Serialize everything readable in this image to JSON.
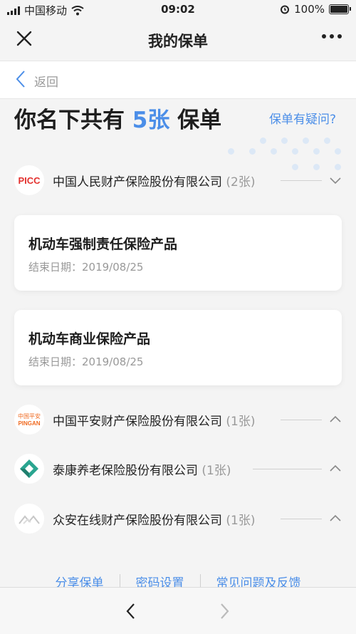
{
  "status_bar": {
    "carrier": "中国移动",
    "time": "09:02",
    "battery": "100%"
  },
  "nav": {
    "title": "我的保单"
  },
  "back": {
    "label": "返回"
  },
  "summary": {
    "prefix": "你名下共有",
    "count": "5张",
    "suffix": "保单",
    "doubt_link": "保单有疑问?"
  },
  "companies": [
    {
      "name": "中国人民财产保险股份有限公司",
      "count": "(2张)",
      "logo_text": "PICC",
      "expanded": true,
      "policies": [
        {
          "title": "机动车强制责任保险产品",
          "end_date": "结束日期：2019/08/25"
        },
        {
          "title": "机动车商业保险产品",
          "end_date": "结束日期：2019/08/25"
        }
      ]
    },
    {
      "name": "中国平安财产保险股份有限公司",
      "count": "(1张)",
      "logo_text_cn": "中国平安",
      "logo_text": "PINGAN",
      "expanded": false
    },
    {
      "name": "泰康养老保险股份有限公司",
      "count": "(1张)",
      "expanded": false
    },
    {
      "name": "众安在线财产保险股份有限公司",
      "count": "(1张)",
      "expanded": false
    }
  ],
  "footer_links": [
    "分享保单",
    "密码设置",
    "常见问题及反馈"
  ],
  "colors": {
    "accent": "#4b8ee8",
    "picc_red": "#e3312e",
    "pingan_orange": "#f06b22",
    "taikang_teal": "#2aa590"
  }
}
